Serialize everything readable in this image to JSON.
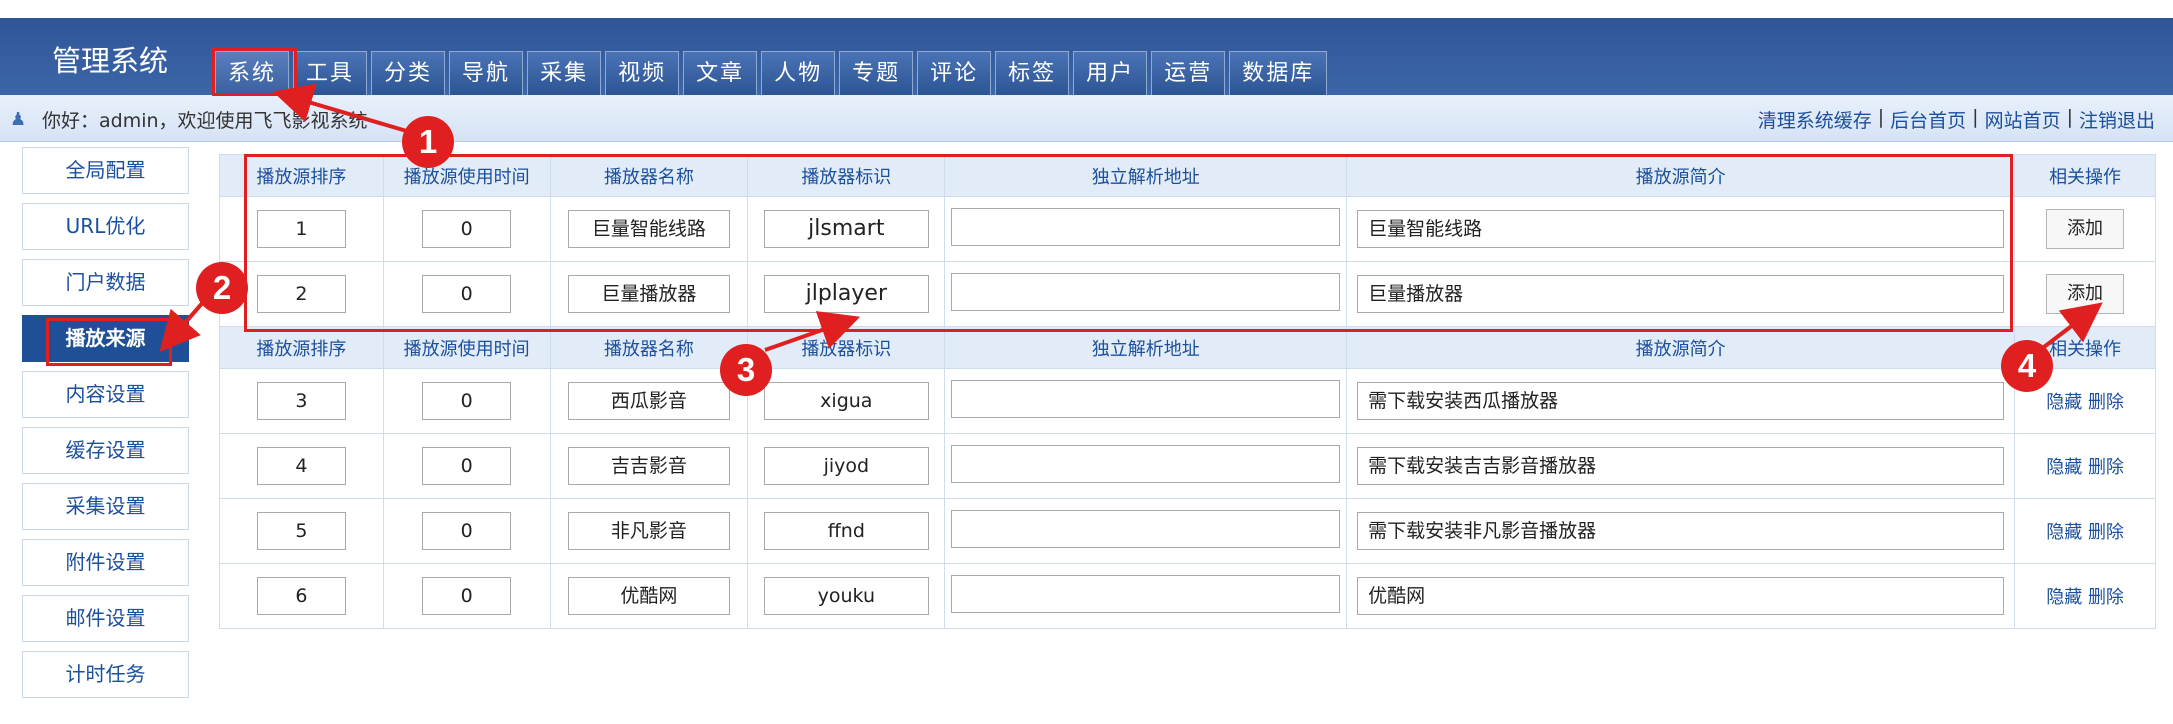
{
  "header": {
    "title": "管理系统",
    "tabs": [
      "系统",
      "工具",
      "分类",
      "导航",
      "采集",
      "视频",
      "文章",
      "人物",
      "专题",
      "评论",
      "标签",
      "用户",
      "运营",
      "数据库"
    ]
  },
  "info_bar": {
    "welcome": "你好：admin，欢迎使用飞飞影视系统",
    "links": [
      "清理系统缓存",
      "后台首页",
      "网站首页",
      "注销退出"
    ],
    "separator": "|"
  },
  "sidebar": {
    "items": [
      "全局配置",
      "URL优化",
      "门户数据",
      "播放来源",
      "内容设置",
      "缓存设置",
      "采集设置",
      "附件设置",
      "邮件设置",
      "计时任务"
    ],
    "active": "播放来源"
  },
  "table": {
    "headers": [
      "播放源排序",
      "播放源使用时间",
      "播放器名称",
      "播放器标识",
      "独立解析地址",
      "播放源简介",
      "相关操作"
    ],
    "new_rows": [
      {
        "order": "1",
        "time": "0",
        "name": "巨量智能线路",
        "id": "jlsmart",
        "url": "",
        "desc": "巨量智能线路",
        "op": "添加"
      },
      {
        "order": "2",
        "time": "0",
        "name": "巨量播放器",
        "id": "jlplayer",
        "url": "",
        "desc": "巨量播放器",
        "op": "添加"
      }
    ],
    "rows": [
      {
        "order": "3",
        "time": "0",
        "name": "西瓜影音",
        "id": "xigua",
        "url": "",
        "desc": "需下载安装西瓜播放器",
        "hide": "隐藏",
        "del": "删除"
      },
      {
        "order": "4",
        "time": "0",
        "name": "吉吉影音",
        "id": "jiyod",
        "url": "",
        "desc": "需下载安装吉吉影音播放器",
        "hide": "隐藏",
        "del": "删除"
      },
      {
        "order": "5",
        "time": "0",
        "name": "非凡影音",
        "id": "ffnd",
        "url": "",
        "desc": "需下载安装非凡影音播放器",
        "hide": "隐藏",
        "del": "删除"
      },
      {
        "order": "6",
        "time": "0",
        "name": "优酷网",
        "id": "youku",
        "url": "",
        "desc": "优酷网",
        "hide": "隐藏",
        "del": "删除"
      }
    ]
  },
  "annotations": {
    "badges": [
      "1",
      "2",
      "3",
      "4"
    ],
    "color": "#e02020"
  },
  "colors": {
    "header_bg": "#2f5597",
    "link": "#1c4f9c",
    "active_sidebar": "#1f4f96"
  }
}
